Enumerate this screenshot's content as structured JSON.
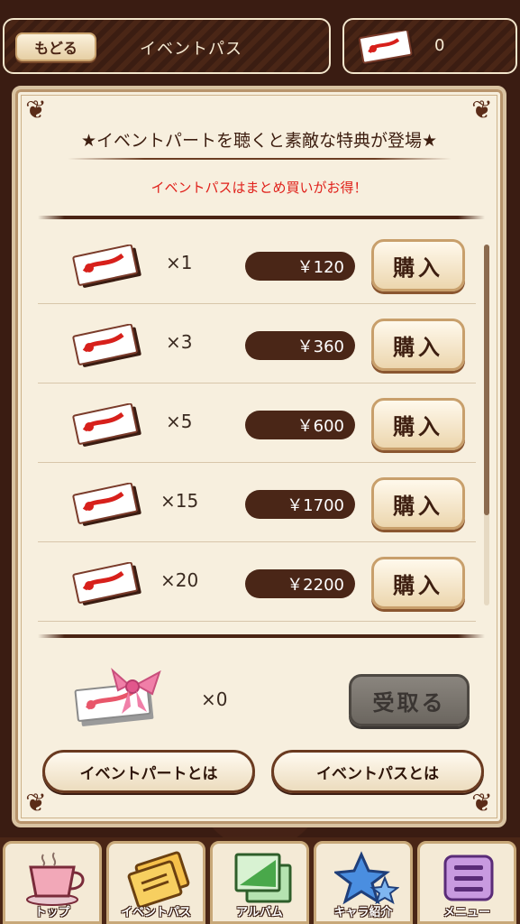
{
  "header": {
    "back_label": "もどる",
    "title": "イベントパス",
    "pass_count": "0"
  },
  "panel": {
    "headline": "★イベントパートを聴くと素敵な特典が登場★",
    "subline": "イベントパスはまとめ買いがお得！"
  },
  "offers": [
    {
      "qty": "×1",
      "price": "￥120",
      "buy_label": "購入"
    },
    {
      "qty": "×3",
      "price": "￥360",
      "buy_label": "購入"
    },
    {
      "qty": "×5",
      "price": "￥600",
      "buy_label": "購入"
    },
    {
      "qty": "×15",
      "price": "￥1700",
      "buy_label": "購入"
    },
    {
      "qty": "×20",
      "price": "￥2200",
      "buy_label": "購入"
    }
  ],
  "bonus": {
    "qty": "×0",
    "receive_label": "受取る"
  },
  "info": {
    "part_label": "イベントパートとは",
    "pass_label": "イベントパスとは"
  },
  "nav": [
    {
      "label": "トップ",
      "icon": "coffee-cup-icon"
    },
    {
      "label": "イベントパス",
      "icon": "tickets-icon"
    },
    {
      "label": "アルバム",
      "icon": "album-icon"
    },
    {
      "label": "キャラ紹介",
      "icon": "star-icon"
    },
    {
      "label": "メニュー",
      "icon": "menu-icon"
    }
  ],
  "colors": {
    "accent_brown": "#4a2617",
    "notice_red": "#e0211b",
    "panel_bg": "#f7efde"
  }
}
